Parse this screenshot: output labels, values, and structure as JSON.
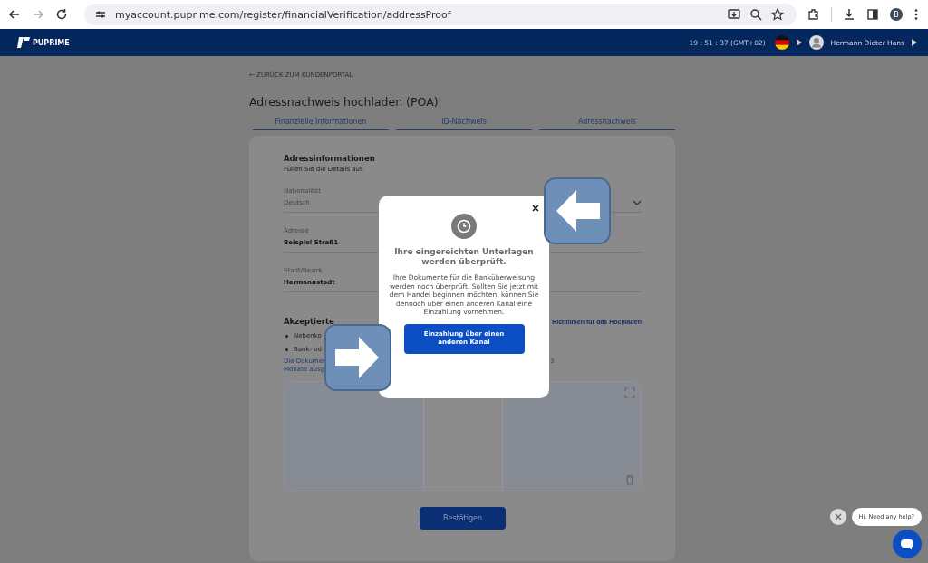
{
  "browser": {
    "url": "myaccount.puprime.com/register/financialVerification/addressProof",
    "profile_initial": "B"
  },
  "header": {
    "logo": "PUPRIME",
    "clock": "19 : 51 : 37 (GMT+02)",
    "user": "Hermann Dieter Hans"
  },
  "back_link": "← ZURÜCK ZUM KUNDENPORTAL",
  "title": "Adressnachweis hochladen (POA)",
  "steps": [
    {
      "label": "Finanzielle Informationen"
    },
    {
      "label": "ID-Nachweis"
    },
    {
      "label": "Adressnachweis"
    }
  ],
  "form": {
    "heading": "Adressinformationen",
    "subheading": "Füllen Sie die Details aus",
    "fields": [
      {
        "label": "Nationalität",
        "value": "Deutsch",
        "kind": "select",
        "disabled": true
      },
      {
        "label": "Adresse",
        "value": "Beispiel Straß1",
        "kind": "text",
        "disabled": false
      },
      {
        "label": "Stadt/Bezirk",
        "value": "Hermannstadt",
        "kind": "text",
        "disabled": false
      }
    ]
  },
  "documents": {
    "heading": "Akzeptierte",
    "guidelines_link": "Richtlinien für das Hochladen",
    "bullets": [
      "Nebenko",
      "Bank- od"
    ],
    "note_lines": [
      "Die Dokumen",
      "Monate ausg"
    ],
    "note_tail": "3"
  },
  "confirm_button": "Bestätigen",
  "modal": {
    "title": "Ihre eingereichten Unterlagen werden überprüft.",
    "body": "Ihre Dokumente für die Banküberweisung werden noch überprüft. Sollten Sie jetzt mit dem Handel beginnen möchten, können Sie dennoch über einen anderen Kanal eine Einzahlung vornehmen.",
    "button": "Einzahlung über einen anderen Kanal"
  },
  "chat": {
    "greeting": "Hi. Need any help?"
  }
}
